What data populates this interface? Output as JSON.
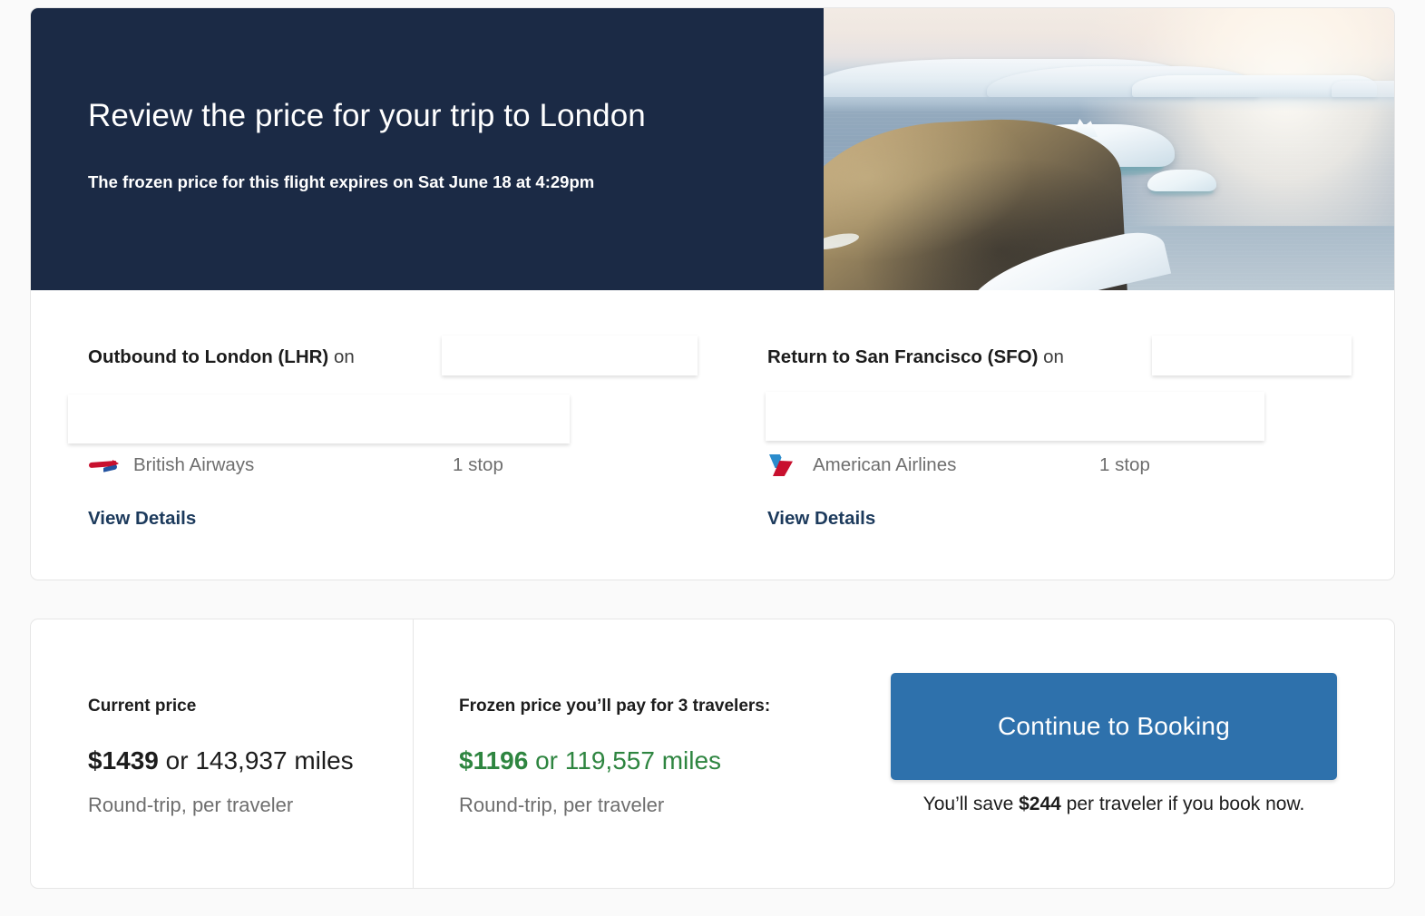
{
  "hero": {
    "title": "Review the price for your trip to London",
    "subtitle": "The frozen price for this flight expires on Sat June 18 at 4:29pm",
    "background_color": "#1b2a45",
    "photo_alt": "arctic-icebergs-photo"
  },
  "flights": {
    "outbound": {
      "heading_bold": "Outbound to London (LHR)",
      "heading_rest": " on",
      "date_value": "",
      "time_value": "",
      "airline": "British Airways",
      "airline_logo": "british-airways-logo",
      "stops": "1 stop",
      "view_details_label": "View Details"
    },
    "inbound": {
      "heading_bold": "Return to San Francisco (SFO)",
      "heading_rest": " on",
      "date_value": "",
      "time_value": "",
      "airline": "American Airlines",
      "airline_logo": "american-airlines-logo",
      "stops": "1 stop",
      "view_details_label": "View Details"
    }
  },
  "pricing": {
    "current": {
      "label": "Current price",
      "amount": "$1439",
      "amount_suffix": " or 143,937 miles",
      "note": "Round-trip, per traveler",
      "color": "#1c1c1c"
    },
    "frozen": {
      "label": "Frozen price you’ll pay for 3 travelers:",
      "amount": "$1196",
      "amount_suffix": " or 119,557 miles",
      "note": "Round-trip, per traveler",
      "color": "#2e8540"
    },
    "cta": {
      "button_label": "Continue to Booking",
      "button_color": "#2e71ac",
      "savings_prefix": "You’ll save ",
      "savings_amount": "$244",
      "savings_suffix": " per traveler if you book now."
    }
  }
}
